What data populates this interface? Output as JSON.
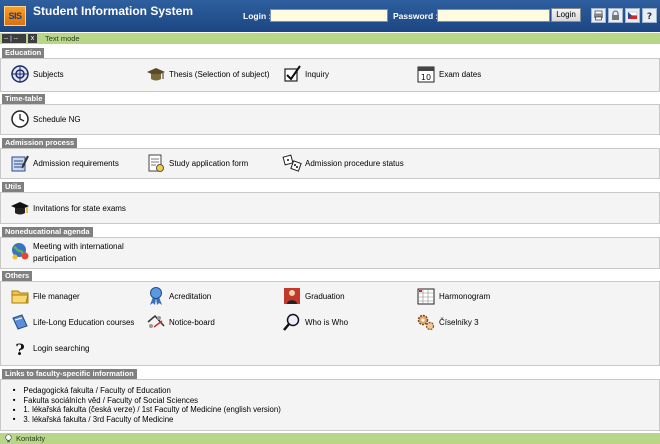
{
  "header": {
    "logo_text": "SIS",
    "title": "Student Information System",
    "login_label": "Login :",
    "password_label": "Password :",
    "login_value": "",
    "password_value": "",
    "login_button": "Login",
    "icons": [
      "print-icon",
      "lock-icon",
      "language-flag-icon",
      "help-icon"
    ]
  },
  "toolbar": {
    "select_value": "-- | --",
    "box_glyph": "x",
    "text_mode": "Text mode"
  },
  "sections": {
    "education": {
      "title": "Education",
      "items": [
        "Subjects",
        "Thesis (Selection of subject)",
        "Inquiry",
        "Exam dates"
      ]
    },
    "timetable": {
      "title": "Time-table",
      "items": [
        "Schedule NG"
      ]
    },
    "admission": {
      "title": "Admission process",
      "items": [
        "Admission requirements",
        "Study application form",
        "Admission procedure status"
      ]
    },
    "utils": {
      "title": "Utils",
      "items": [
        "Invitations for state exams"
      ]
    },
    "noneducational": {
      "title": "Noneducational agenda",
      "items": [
        "Meeting with international participation"
      ]
    },
    "others": {
      "title": "Others",
      "items": [
        "File manager",
        "Acreditation",
        "Graduation",
        "Harmonogram",
        "Life-Long Education courses",
        "Notice-board",
        "Who is Who",
        "Číselníky 3",
        "Login searching"
      ]
    },
    "links": {
      "title": "Links to faculty-specific information",
      "items": [
        "Pedagogická fakulta / Faculty of Education",
        "Fakulta sociálních věd / Faculty of Social Sciences",
        "1. lékařská fakulta (česká verze) / 1st Faculty of Medicine (english version)",
        "3. lékařská fakulta / 3rd Faculty of Medicine"
      ]
    }
  },
  "footer": {
    "label": "Kontakty"
  },
  "colors": {
    "header_blue": "#1c4683",
    "toolbar_green": "#b7d68a",
    "section_grey": "#808080"
  }
}
